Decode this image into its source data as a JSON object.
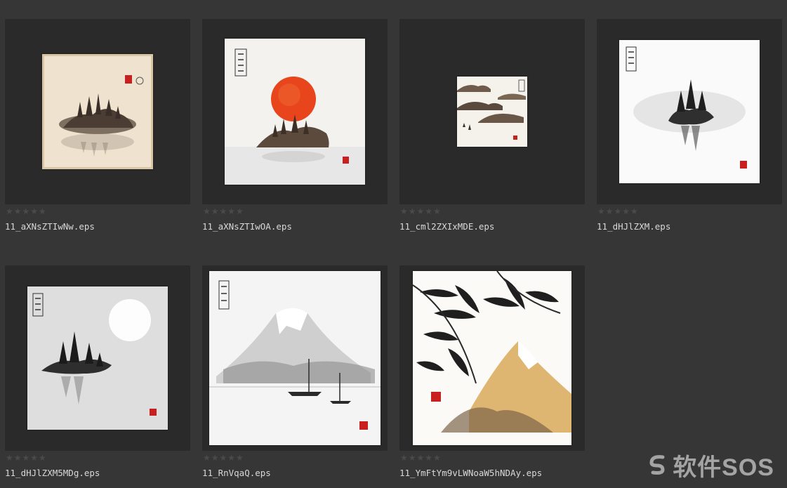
{
  "gallery": {
    "items": [
      {
        "filename": "11_aXNsZTIwNw.eps",
        "rating": "★★★★★"
      },
      {
        "filename": "11_aXNsZTIwOA.eps",
        "rating": "★★★★★"
      },
      {
        "filename": "11_cml2ZXIxMDE.eps",
        "rating": "★★★★★"
      },
      {
        "filename": "11_dHJlZXM.eps",
        "rating": "★★★★★"
      },
      {
        "filename": "11_dHJlZXM5MDg.eps",
        "rating": "★★★★★"
      },
      {
        "filename": "11_RnVqaQ.eps",
        "rating": "★★★★★"
      },
      {
        "filename": "11_YmFtYm9vLWNoaW5hNDAy.eps",
        "rating": "★★★★★"
      }
    ]
  },
  "watermark": {
    "text": "软件SOS",
    "icon": "s-logo-icon"
  },
  "colors": {
    "background": "#363636",
    "cell": "#2a2a2a",
    "filename": "#d8d8d8",
    "stars": "#4a4a4a",
    "seal": "#c8201e",
    "sun": "#e8451c"
  }
}
